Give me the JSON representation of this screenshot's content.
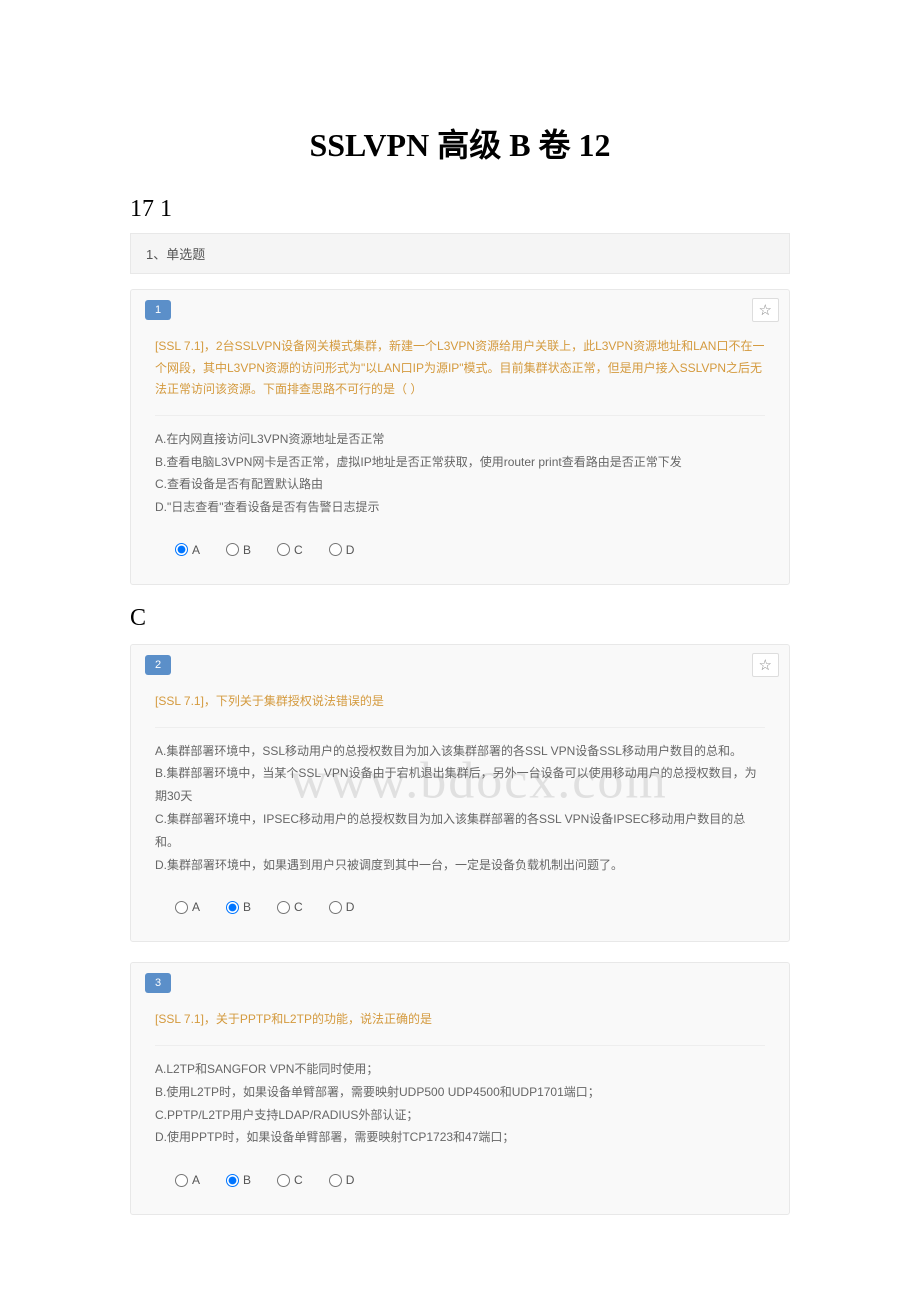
{
  "title": "SSLVPN 高级 B 卷 12",
  "subNumber": "17 1",
  "sectionLabel": "1、单选题",
  "answer1": "C",
  "watermark": "www.bdocx.com",
  "questions": [
    {
      "num": "1",
      "prompt": "[SSL 7.1]，2台SSLVPN设备网关模式集群，新建一个L3VPN资源给用户关联上，此L3VPN资源地址和LAN口不在一个网段，其中L3VPN资源的访问形式为\"以LAN口IP为源IP\"模式。目前集群状态正常，但是用户接入SSLVPN之后无法正常访问该资源。下面排查思路不可行的是（ ）",
      "opts": [
        "A.在内网直接访问L3VPN资源地址是否正常",
        "B.查看电脑L3VPN网卡是否正常，虚拟IP地址是否正常获取，使用router print查看路由是否正常下发",
        "C.查看设备是否有配置默认路由",
        "D.\"日志查看\"查看设备是否有告警日志提示"
      ],
      "selected": "A",
      "hasStar": true
    },
    {
      "num": "2",
      "prompt": "[SSL 7.1]，下列关于集群授权说法错误的是",
      "opts": [
        "A.集群部署环境中，SSL移动用户的总授权数目为加入该集群部署的各SSL VPN设备SSL移动用户数目的总和。",
        "B.集群部署环境中，当某个SSL VPN设备由于宕机退出集群后，另外一台设备可以使用移动用户的总授权数目，为期30天",
        "C.集群部署环境中，IPSEC移动用户的总授权数目为加入该集群部署的各SSL VPN设备IPSEC移动用户数目的总和。",
        "D.集群部署环境中，如果遇到用户只被调度到其中一台，一定是设备负载机制出问题了。"
      ],
      "selected": "B",
      "hasStar": true,
      "watermark": true
    },
    {
      "num": "3",
      "prompt": "[SSL 7.1]，关于PPTP和L2TP的功能，说法正确的是",
      "opts": [
        "A.L2TP和SANGFOR VPN不能同时使用；",
        "B.使用L2TP时，如果设备单臂部署，需要映射UDP500 UDP4500和UDP1701端口；",
        "C.PPTP/L2TP用户支持LDAP/RADIUS外部认证；",
        "D.使用PPTP时，如果设备单臂部署，需要映射TCP1723和47端口；"
      ],
      "selected": "B",
      "hasStar": false
    }
  ],
  "radioLabels": [
    "A",
    "B",
    "C",
    "D"
  ]
}
